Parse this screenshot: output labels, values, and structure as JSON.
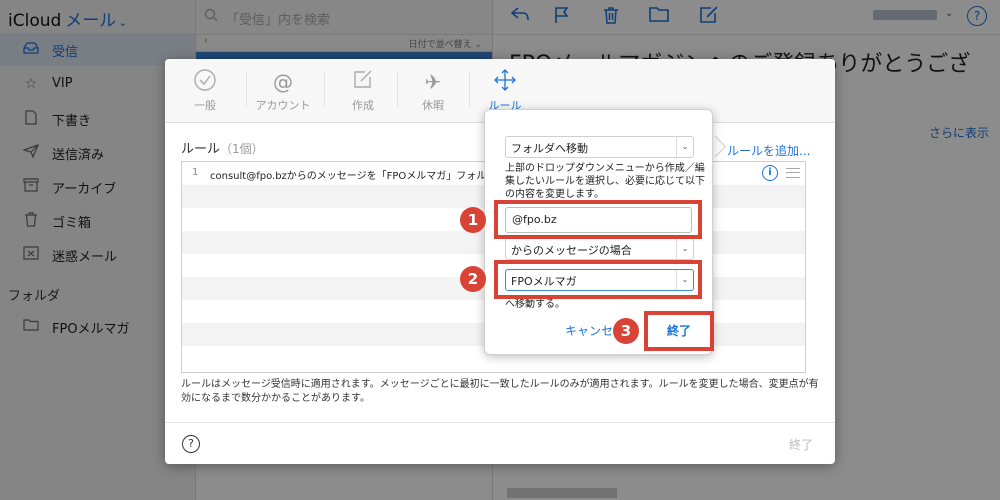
{
  "sidebar": {
    "brand": "iCloud",
    "app_name": "メール",
    "items": [
      {
        "label": "受信",
        "icon": "inbox-icon",
        "active": true
      },
      {
        "label": "VIP",
        "icon": "star-icon"
      },
      {
        "label": "下書き",
        "icon": "document-icon"
      },
      {
        "label": "送信済み",
        "icon": "paper-plane-icon"
      },
      {
        "label": "アーカイブ",
        "icon": "archive-box-icon"
      },
      {
        "label": "ゴミ箱",
        "icon": "trash-icon"
      },
      {
        "label": "迷惑メール",
        "icon": "junk-icon"
      }
    ],
    "section_label": "フォルダ",
    "folders": [
      {
        "label": "FPOメルマガ",
        "icon": "folder-icon"
      }
    ]
  },
  "message_list": {
    "search_placeholder": "「受信」内を検索",
    "sort_label": "日付で並べ替え"
  },
  "reader": {
    "subject": "FPOメールマガジンへのご登録ありがとうござ",
    "more_label": "さらに表示"
  },
  "preferences": {
    "tabs": [
      {
        "label": "一般",
        "icon": "checkmark-circle-icon"
      },
      {
        "label": "アカウント",
        "icon": "at-sign-icon"
      },
      {
        "label": "作成",
        "icon": "compose-icon"
      },
      {
        "label": "休暇",
        "icon": "airplane-icon"
      },
      {
        "label": "ルール",
        "icon": "move-arrows-icon",
        "active": true
      }
    ],
    "rules_title": "ルール",
    "rules_count": "（1個）",
    "add_rule_label": "ルールを追加...",
    "rule_row": {
      "number": "1",
      "text": "consult@fpo.bzからのメッセージを「FPOメルマガ」フォル"
    },
    "note": "ルールはメッセージ受信時に適用されます。メッセージごとに最初に一致したルールのみが適用されます。ルールを変更した場合、変更点が有効になるまで数分かかることがあります。",
    "done_label": "終了"
  },
  "popover": {
    "action_select": "フォルダへ移動",
    "help_text": "上部のドロップダウンメニューから作成／編集したいルールを選択し、必要に応じて以下の内容を変更します。",
    "address_value": "@fpo.bz",
    "condition_select": "からのメッセージの場合",
    "folder_select": "FPOメルマガ",
    "move_text": "へ移動する。",
    "cancel_label": "キャンセル",
    "done_label": "終了"
  },
  "annotations": {
    "badge1": "1",
    "badge2": "2",
    "badge3": "3",
    "color": "#d84335"
  },
  "colors": {
    "accent": "#1a73d9"
  }
}
